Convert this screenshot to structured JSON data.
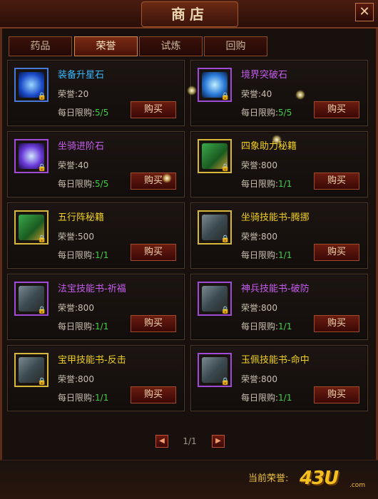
{
  "window": {
    "title": "商店",
    "close_label": "✕"
  },
  "tabs": [
    {
      "label": "药品"
    },
    {
      "label": "荣誉"
    },
    {
      "label": "试炼"
    },
    {
      "label": "回购"
    }
  ],
  "active_tab": "荣誉",
  "items": [
    {
      "name": "装备升星石",
      "honor": "荣誉:20",
      "limit_label": "每日限购:",
      "limit_value": "5/5",
      "buy_label": "购买",
      "name_color": "blue",
      "frame": "blue",
      "icon": "star-stone-icon"
    },
    {
      "name": "境界突破石",
      "honor": "荣誉:40",
      "limit_label": "每日限购:",
      "limit_value": "5/5",
      "buy_label": "购买",
      "name_color": "purple",
      "frame": "purple",
      "icon": "realm-stone-icon"
    },
    {
      "name": "坐骑进阶石",
      "honor": "荣誉:40",
      "limit_label": "每日限购:",
      "limit_value": "5/5",
      "buy_label": "购买",
      "name_color": "purple",
      "frame": "purple",
      "icon": "mount-stone-icon"
    },
    {
      "name": "四象助力秘籍",
      "honor": "荣誉:800",
      "limit_label": "每日限购:",
      "limit_value": "1/1",
      "buy_label": "购买",
      "name_color": "gold",
      "frame": "gold",
      "icon": "book-icon"
    },
    {
      "name": "五行阵秘籍",
      "honor": "荣誉:500",
      "limit_label": "每日限购:",
      "limit_value": "1/1",
      "buy_label": "购买",
      "name_color": "gold",
      "frame": "gold",
      "icon": "book-icon"
    },
    {
      "name": "坐骑技能书-腾挪",
      "honor": "荣誉:800",
      "limit_label": "每日限购:",
      "limit_value": "1/1",
      "buy_label": "购买",
      "name_color": "gold",
      "frame": "gold",
      "icon": "skill-book-icon"
    },
    {
      "name": "法宝技能书-祈福",
      "honor": "荣誉:800",
      "limit_label": "每日限购:",
      "limit_value": "1/1",
      "buy_label": "购买",
      "name_color": "purple",
      "frame": "purple",
      "icon": "skill-book-icon"
    },
    {
      "name": "神兵技能书-破防",
      "honor": "荣誉:800",
      "limit_label": "每日限购:",
      "limit_value": "1/1",
      "buy_label": "购买",
      "name_color": "purple",
      "frame": "purple",
      "icon": "skill-book-icon"
    },
    {
      "name": "宝甲技能书-反击",
      "honor": "荣誉:800",
      "limit_label": "每日限购:",
      "limit_value": "1/1",
      "buy_label": "购买",
      "name_color": "gold",
      "frame": "gold",
      "icon": "skill-book-icon"
    },
    {
      "name": "玉佩技能书-命中",
      "honor": "荣誉:800",
      "limit_label": "每日限购:",
      "limit_value": "1/1",
      "buy_label": "购买",
      "name_color": "gold",
      "frame": "purple",
      "icon": "skill-book-icon"
    }
  ],
  "pager": {
    "prev_label": "◀",
    "page_text": "1/1",
    "next_label": "▶"
  },
  "footer": {
    "current_honor_label": "当前荣誉:",
    "logo_text": "43U",
    "logo_sub": ".com"
  },
  "colors": {
    "name_blue": "#3ab8ff",
    "name_purple": "#c65cf0",
    "name_gold": "#f0d020",
    "limit_green": "#40d040"
  }
}
